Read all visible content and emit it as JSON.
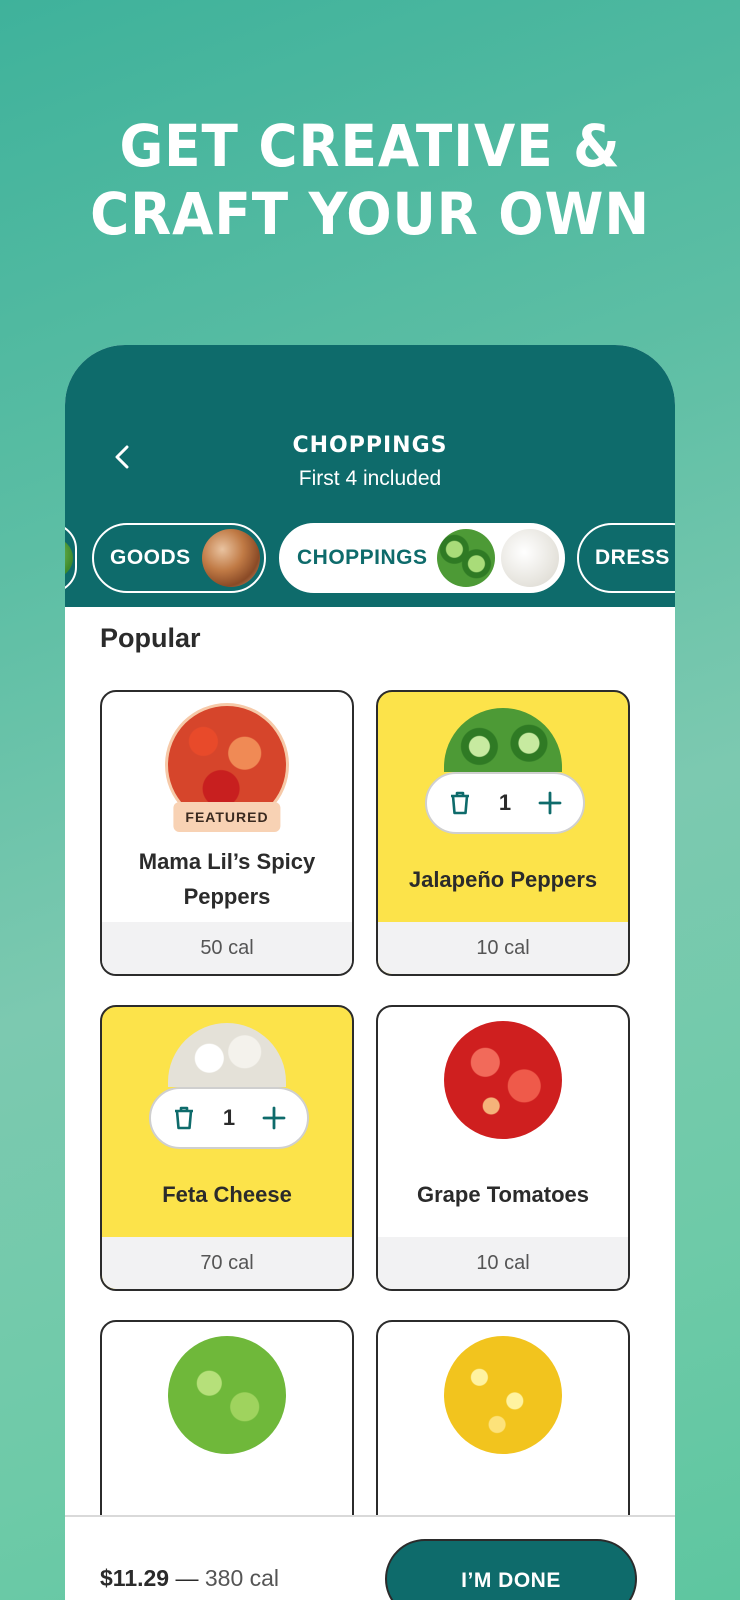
{
  "headline": {
    "line1": "GET CREATIVE &",
    "line2": "CRAFT YOUR OWN"
  },
  "header": {
    "title": "CHOPPINGS",
    "subtitle": "First 4 included"
  },
  "categories": [
    {
      "label": "GOODS",
      "active": false
    },
    {
      "label": "CHOPPINGS",
      "active": true
    },
    {
      "label": "DRESS"
    }
  ],
  "section": {
    "title": "Popular"
  },
  "items": [
    {
      "name": "Mama Lil’s Spicy Peppers",
      "cal": "50 cal",
      "badge": "FEATURED",
      "selected": false
    },
    {
      "name": "Jalapeño Peppers",
      "cal": "10 cal",
      "selected": true,
      "qty": "1"
    },
    {
      "name": "Feta Cheese",
      "cal": "70 cal",
      "selected": true,
      "qty": "1"
    },
    {
      "name": "Grape Tomatoes",
      "cal": "10 cal",
      "selected": false
    },
    {
      "name": "",
      "cal": "",
      "selected": false
    },
    {
      "name": "",
      "cal": "",
      "selected": false
    }
  ],
  "footer": {
    "price": "$11.29",
    "separator": " — ",
    "calories": "380 cal",
    "done_label": "I’M DONE"
  },
  "colors": {
    "header": "#0e6b6b",
    "selected_card": "#fce34a",
    "featured_badge": "#f8d2b4"
  }
}
